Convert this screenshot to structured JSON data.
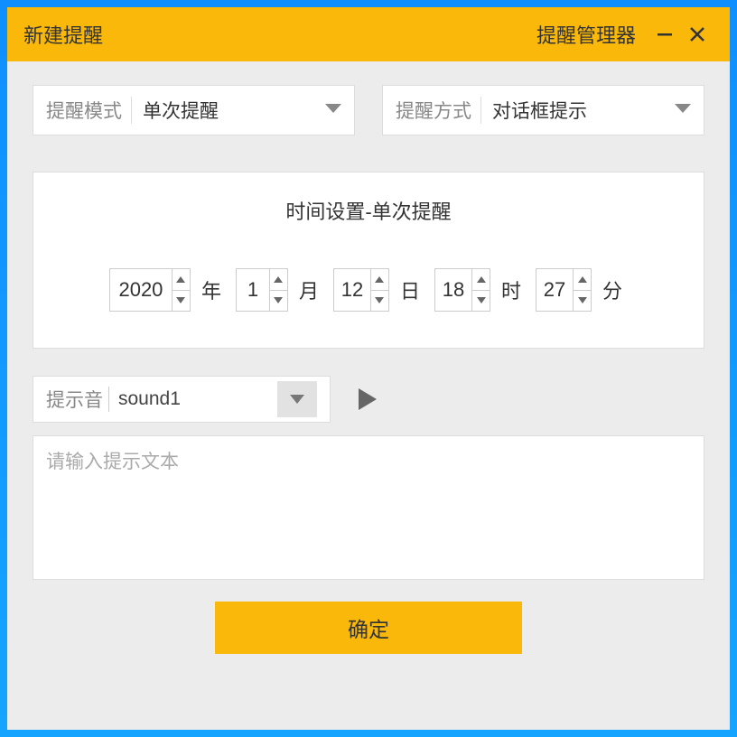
{
  "titlebar": {
    "title": "新建提醒",
    "manager": "提醒管理器"
  },
  "mode": {
    "label": "提醒模式",
    "value": "单次提醒"
  },
  "method": {
    "label": "提醒方式",
    "value": "对话框提示"
  },
  "time_panel": {
    "title": "时间设置-单次提醒",
    "year": "2020",
    "year_unit": "年",
    "month": "1",
    "month_unit": "月",
    "day": "12",
    "day_unit": "日",
    "hour": "18",
    "hour_unit": "时",
    "minute": "27",
    "minute_unit": "分"
  },
  "sound": {
    "label": "提示音",
    "value": "sound1"
  },
  "textarea": {
    "placeholder": "请输入提示文本"
  },
  "buttons": {
    "ok": "确定"
  },
  "colors": {
    "accent": "#f9b80a",
    "window_blue": "#15a4ff"
  }
}
